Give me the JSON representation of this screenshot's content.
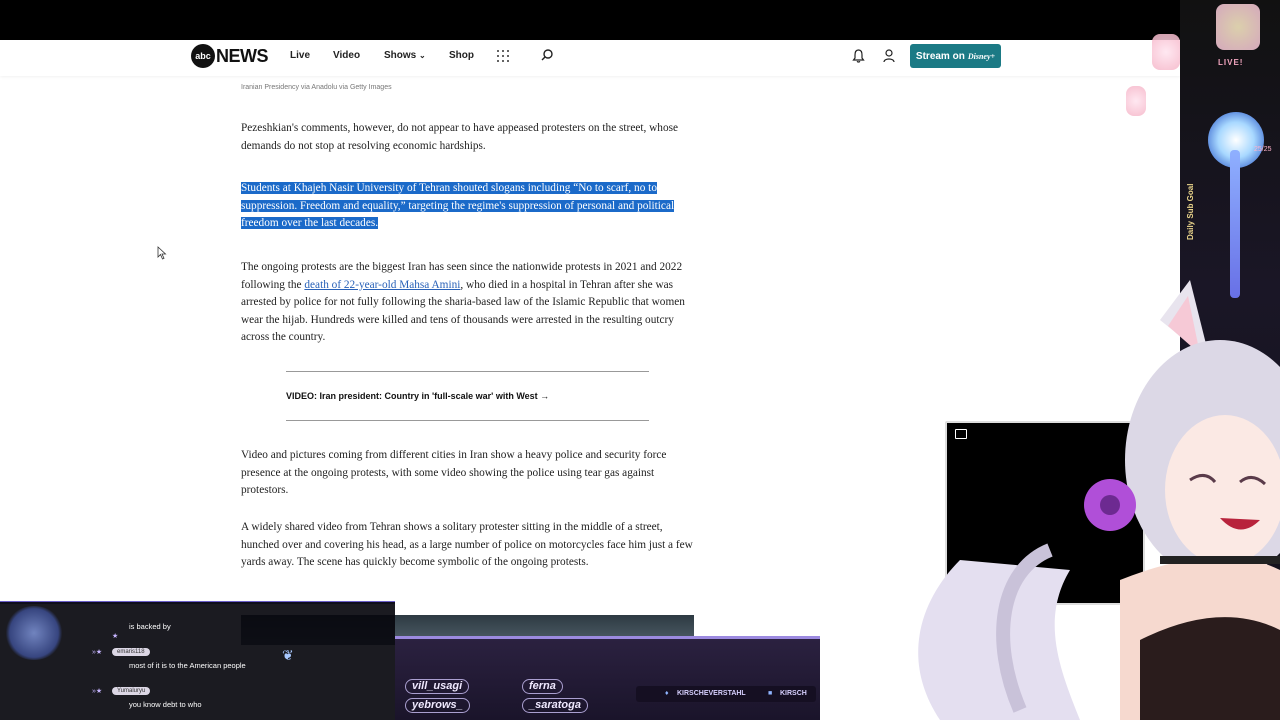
{
  "nav": {
    "logo_abc": "abc",
    "logo_news": "NEWS",
    "items": [
      "Live",
      "Video",
      "Shows",
      "Shop"
    ],
    "stream_label": "Stream on",
    "stream_brand": "Disney+"
  },
  "article": {
    "image_caption": "Iranian Presidency via Anadolu via Getty Images",
    "p1": "Pezeshkian's comments, however, do not appear to have appeased protesters on the street, whose demands do not stop at resolving economic hardships.",
    "p2": "Students at Khajeh Nasir University of Tehran shouted slogans including “No to scarf, no to suppression. Freedom and equality,” targeting the regime's suppression of personal and political freedom over the last decades.",
    "p3_before": "The ongoing protests are the biggest Iran has seen since the nationwide protests in 2021 and 2022 following the ",
    "p3_link": "death of 22-year-old Mahsa Amini",
    "p3_after": ", who died in a hospital in Tehran after she was arrested by police for not fully following the sharia-based law of the Islamic Republic that women wear the hijab. Hundreds were killed and tens of thousands were arrested in the resulting outcry across the country.",
    "video_link": "VIDEO: Iran president: Country in 'full-scale war' with West",
    "p4": "Video and pictures coming from different cities in Iran show a heavy police and security force presence at the ongoing protests, with some video showing the police using tear gas against protestors.",
    "p5": "A widely shared video from Tehran shows a solitary protester sitting in the middle of a street, hunched over and covering his head, as a large number of police on motorcycles face him just a few yards away. The scene has quickly become symbolic of the ongoing protests."
  },
  "overlay": {
    "live_tag": "LIVE!",
    "sub_goal": "Daily Sub Goal",
    "sub_count": "25/25"
  },
  "chat": {
    "messages": [
      {
        "user": "",
        "text": "is backed by"
      },
      {
        "user": "emaris118",
        "text": "most of it is to the American people"
      },
      {
        "user": "Yumaluryu",
        "text": "you know debt to who"
      }
    ]
  },
  "ticker": {
    "names": [
      "vill_usagi",
      "ferna",
      "yebrows_",
      "_saratoga"
    ],
    "twitter": "KIRSCHEVERSTAHL",
    "discord": "KIRSCH"
  },
  "colors": {
    "highlight": "#1b6ac9",
    "stream_btn": "#1b7a85",
    "link": "#2861b8"
  }
}
